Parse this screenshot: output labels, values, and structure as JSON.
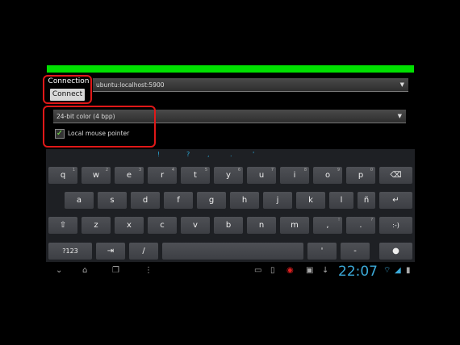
{
  "connection": {
    "label": "Connection",
    "connect_button": "Connect",
    "host_value": "ubuntu:localhost:5900"
  },
  "settings": {
    "color_depth_value": "24-bit color (4 bpp)",
    "local_mouse_label": "Local mouse pointer",
    "local_mouse_checked": true
  },
  "keyboard": {
    "suggestions": [
      "!",
      "?",
      ",",
      ".",
      "'"
    ],
    "row1": [
      "q",
      "w",
      "e",
      "r",
      "t",
      "y",
      "u",
      "i",
      "o",
      "p"
    ],
    "row1_hints": [
      "1",
      "2",
      "3",
      "4",
      "5",
      "6",
      "7",
      "8",
      "9",
      "0"
    ],
    "row2": [
      "a",
      "s",
      "d",
      "f",
      "g",
      "h",
      "j",
      "k",
      "l",
      "ñ"
    ],
    "row3": [
      "z",
      "x",
      "c",
      "v",
      "b",
      "n",
      "m",
      ",",
      "."
    ],
    "row3_hints": [
      "",
      "",
      "",
      "",
      "",
      "",
      "",
      "!",
      "?"
    ],
    "smile_key": ":-)",
    "symbols_key": "?123",
    "slash_key": "/",
    "apostrophe_key": "'",
    "dash_key": "-"
  },
  "status_bar": {
    "time": "22:07"
  },
  "icons": {
    "backspace": "backspace-icon",
    "enter": "enter-icon",
    "shift": "shift-icon",
    "tab": "tab-icon",
    "mic": "mic-icon",
    "back": "nav-back-icon",
    "home": "nav-home-icon",
    "recents": "nav-recents-icon",
    "menu": "menu-icon"
  },
  "colors": {
    "progress_bar": "#00e000",
    "highlight_box": "#e01818",
    "clock": "#3ba9d8",
    "suggestion": "#2aa9d8"
  }
}
